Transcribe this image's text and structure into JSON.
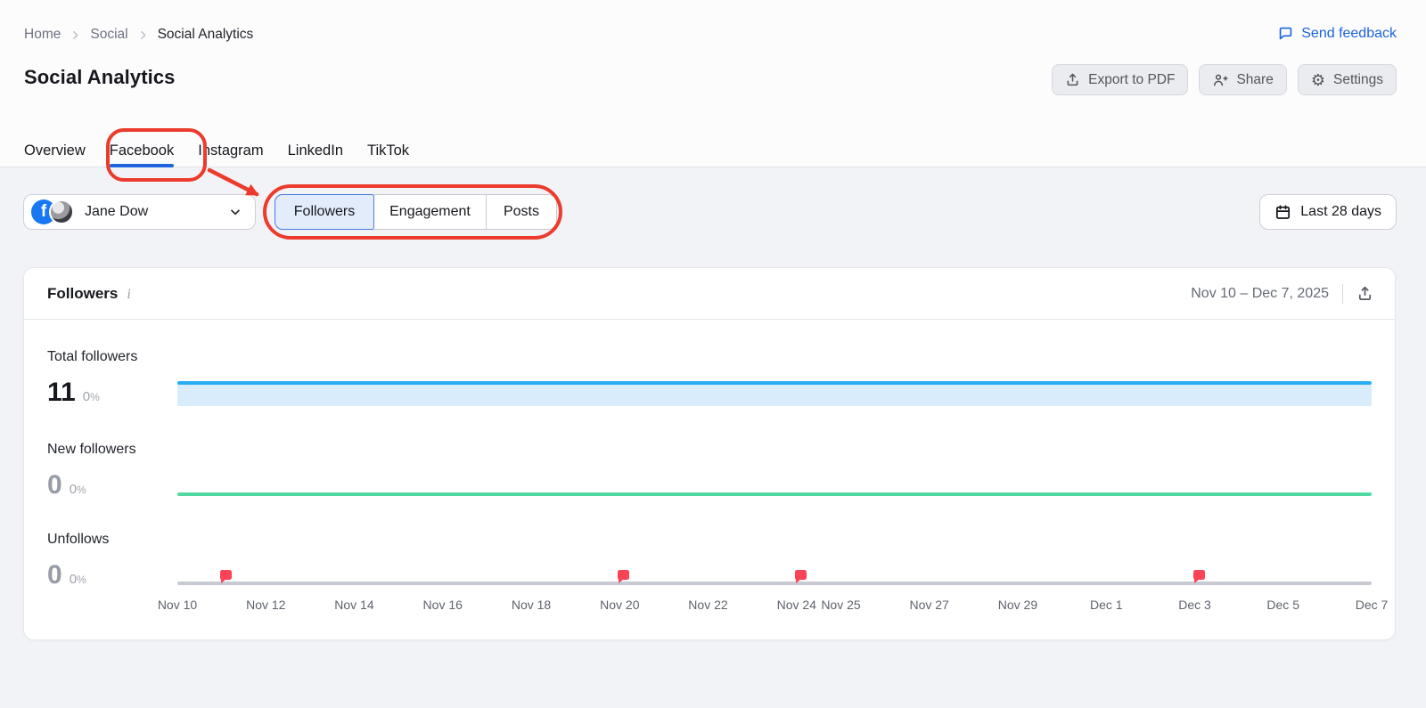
{
  "breadcrumb": {
    "items": [
      "Home",
      "Social",
      "Social Analytics"
    ]
  },
  "feedback": {
    "label": "Send feedback"
  },
  "page": {
    "title": "Social Analytics"
  },
  "actions": {
    "export_pdf_label": "Export to PDF",
    "share_label": "Share",
    "settings_label": "Settings"
  },
  "tabs": [
    {
      "label": "Overview",
      "active": false
    },
    {
      "label": "Facebook",
      "active": true
    },
    {
      "label": "Instagram",
      "active": false
    },
    {
      "label": "LinkedIn",
      "active": false
    },
    {
      "label": "TikTok",
      "active": false
    }
  ],
  "profile": {
    "name": "Jane Dow",
    "network": "Facebook"
  },
  "view_switcher": {
    "selected": "Followers",
    "options": [
      "Followers",
      "Engagement",
      "Posts"
    ]
  },
  "date_filter": {
    "label": "Last 28 days"
  },
  "panel": {
    "title": "Followers",
    "date_range": "Nov 10 – Dec 7, 2025"
  },
  "chart_data": {
    "type": "line",
    "title": "Followers",
    "date_range": "Nov 10 – Dec 7, 2025",
    "x_ticks": [
      "Nov 10",
      "Nov 12",
      "Nov 14",
      "Nov 16",
      "Nov 18",
      "Nov 20",
      "Nov 22",
      "Nov 24",
      "Nov 25",
      "Nov 27",
      "Nov 29",
      "Dec 1",
      "Dec 3",
      "Dec 5",
      "Dec 7"
    ],
    "x_range_days": 28,
    "grid": false,
    "series": [
      {
        "name": "Total followers",
        "display_value": "11",
        "change_value": "0",
        "change_sign": "%",
        "constant_value": 11,
        "color": "#27aef2",
        "fill": "#d9ecfb"
      },
      {
        "name": "New followers",
        "display_value": "0",
        "change_value": "0",
        "change_sign": "%",
        "constant_value": 0,
        "color": "#4fd9a1"
      },
      {
        "name": "Unfollows",
        "display_value": "0",
        "change_value": "0",
        "change_sign": "%",
        "constant_value": 0,
        "color": "#c7cad3"
      }
    ],
    "event_markers": {
      "dates": [
        "Nov 11",
        "Nov 20",
        "Nov 24",
        "Dec 3"
      ],
      "color": "#fb4355"
    }
  }
}
